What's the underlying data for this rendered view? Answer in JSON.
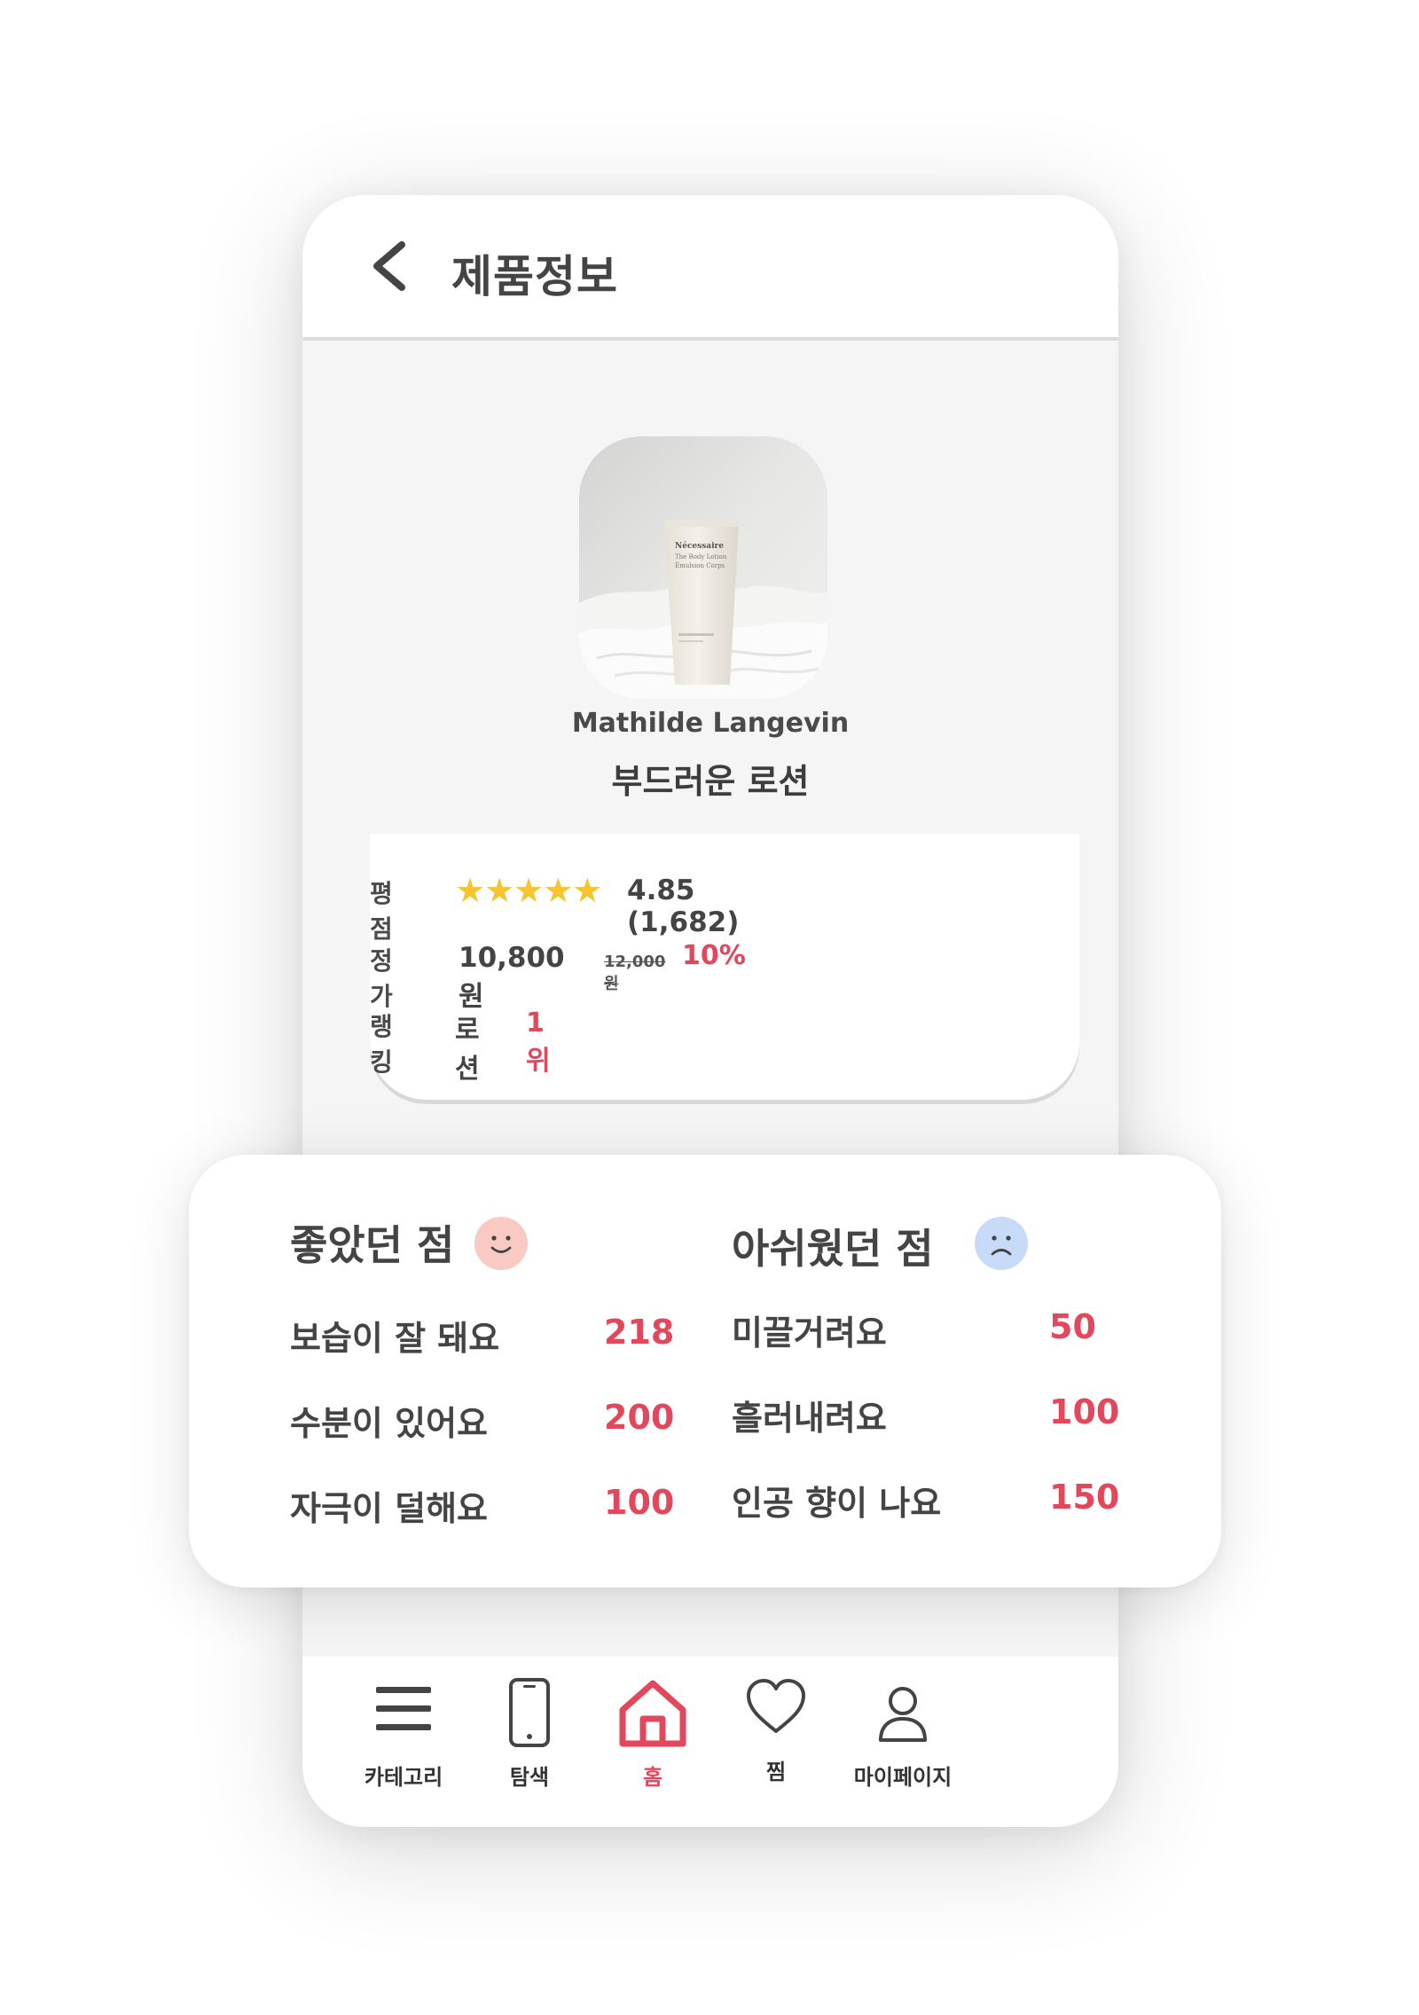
{
  "header": {
    "title": "제품정보"
  },
  "product": {
    "brand": "Mathilde Langevin",
    "name": "부드러운 로션",
    "tube_text": [
      "Nécessaire",
      "The Body Lotion",
      "Émulsion Corps"
    ]
  },
  "info": {
    "rating": {
      "label": "평점",
      "stars": "★★★★★",
      "star_value": 5,
      "text": "4.85 (1,682)"
    },
    "price": {
      "label": "정가",
      "price": "10,800원",
      "original_price": "12,000원",
      "discount": "10%"
    },
    "ranking": {
      "label": "랭킹",
      "category": "로션",
      "rank": "1위"
    }
  },
  "reviews": {
    "good": {
      "title": "좋았던 점",
      "items": [
        {
          "label": "보습이 잘 돼요",
          "count": "218"
        },
        {
          "label": "수분이 있어요",
          "count": "200"
        },
        {
          "label": "자극이 덜해요",
          "count": "100"
        }
      ]
    },
    "bad": {
      "title": "아쉬웠던 점",
      "items": [
        {
          "label": "미끌거려요",
          "count": "50"
        },
        {
          "label": "흘러내려요",
          "count": "100"
        },
        {
          "label": "인공 향이 나요",
          "count": "150"
        }
      ]
    }
  },
  "nav": {
    "items": [
      {
        "label": "카테고리",
        "icon": "menu-icon"
      },
      {
        "label": "탐색",
        "icon": "phone-icon"
      },
      {
        "label": "홈",
        "icon": "home-icon",
        "active": true
      },
      {
        "label": "찜",
        "icon": "heart-icon"
      },
      {
        "label": "마이페이지",
        "icon": "user-icon"
      }
    ]
  },
  "colors": {
    "accent": "#e2475c",
    "star": "#f7c32e",
    "smile_face": "#f9c9c3",
    "sad_face": "#c7daf7",
    "text": "#444444"
  }
}
